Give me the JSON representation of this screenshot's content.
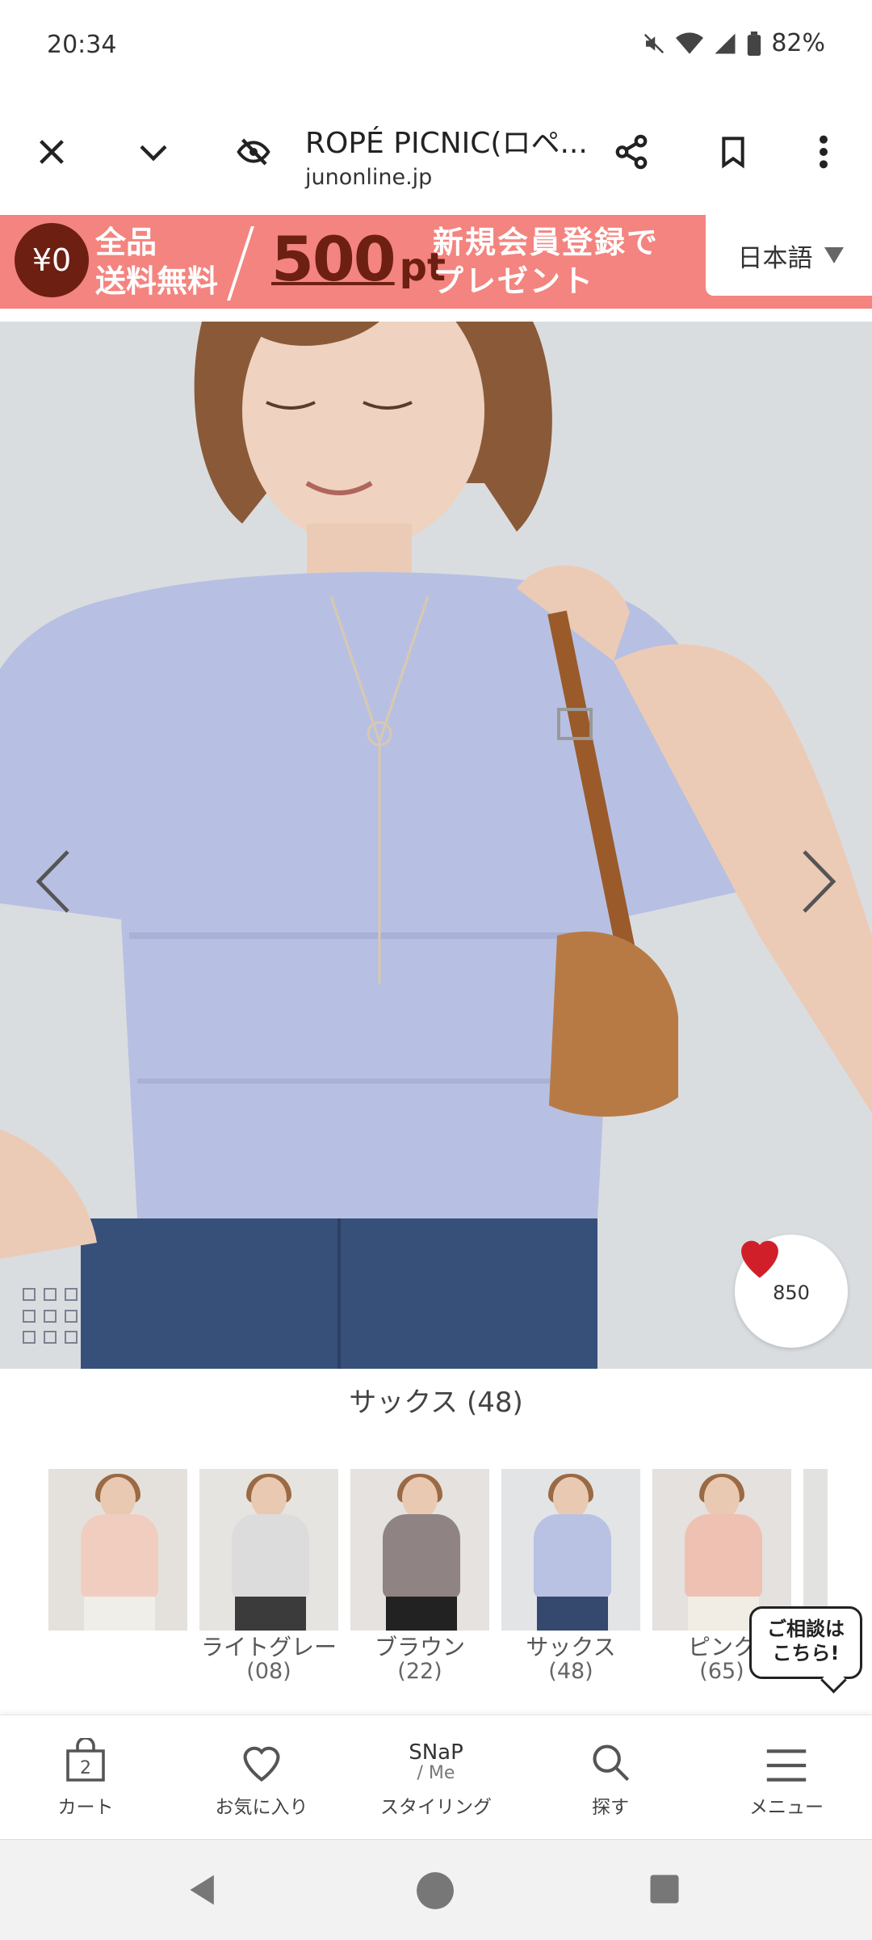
{
  "status_bar": {
    "time": "20:34",
    "battery": "82%"
  },
  "browser": {
    "title": "ROPÉ PICNIC(ロペ...",
    "url": "junonline.jp"
  },
  "banner": {
    "coin": "¥0",
    "free_line1": "全品",
    "free_line2": "送料無料",
    "points_value": "500",
    "points_unit": "pt",
    "promo_line1": "新規会員登録で",
    "promo_line2": "プレゼント",
    "language": "日本語"
  },
  "product": {
    "favorite_count": "850",
    "selected_color": "サックス (48)"
  },
  "swatches": [
    {
      "name": "",
      "code": "",
      "shirt_color": "#f1cdbf",
      "pants_color": "#efeee8",
      "bg": "#e4e1dd"
    },
    {
      "name": "ライトグレー",
      "code": "(08)",
      "shirt_color": "#dcdcdc",
      "pants_color": "#3b3b3b",
      "bg": "#e6e4e0"
    },
    {
      "name": "ブラウン",
      "code": "(22)",
      "shirt_color": "#8f8384",
      "pants_color": "#222222",
      "bg": "#e5e2df"
    },
    {
      "name": "サックス",
      "code": "(48)",
      "shirt_color": "#b9c2e3",
      "pants_color": "#34496d",
      "bg": "#e3e4e6"
    },
    {
      "name": "ピンク",
      "code": "(65)",
      "shirt_color": "#efc1b3",
      "pants_color": "#f1ece4",
      "bg": "#e4e1de"
    }
  ],
  "chat_bubble": {
    "line1": "ご相談は",
    "line2": "こちら!"
  },
  "bottom_nav": {
    "cart_badge": "2",
    "cart": "カート",
    "favorites": "お気に入り",
    "snap_logo_top": "SNaP",
    "snap_logo_bottom": "/ Me",
    "styling": "スタイリング",
    "search": "探す",
    "menu": "メニュー"
  }
}
